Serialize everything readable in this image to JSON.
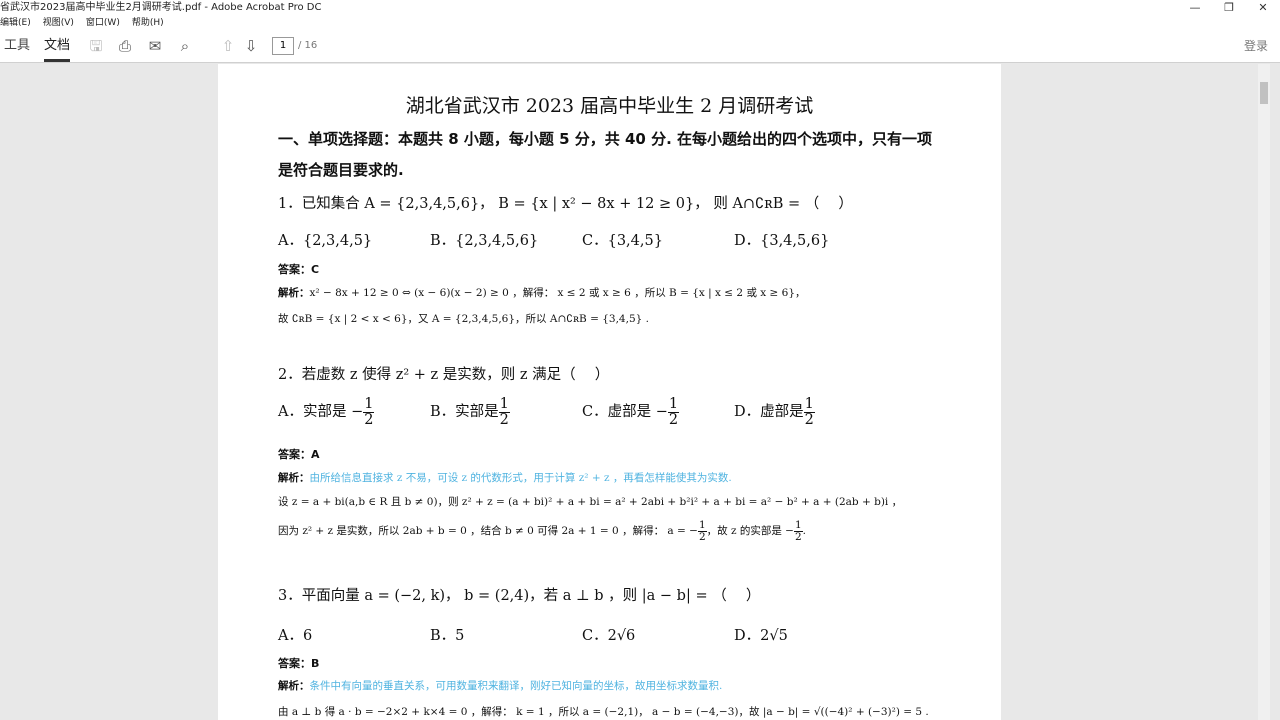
{
  "window": {
    "title": "省武汉市2023届高中毕业生2月调研考试.pdf - Adobe Acrobat Pro DC",
    "minimize": "—",
    "restore": "❐",
    "close": "✕"
  },
  "menu": [
    "编辑(E)",
    "视图(V)",
    "窗口(W)",
    "帮助(H)"
  ],
  "toolbar": {
    "tools": "工具",
    "document": "文档",
    "page_current": "1",
    "page_total": "/ 16",
    "login": "登录"
  },
  "doc": {
    "title": "湖北省武汉市 2023 届高中毕业生 2 月调研考试",
    "section_line1": "一、单项选择题：本题共 8 小题，每小题 5 分，共 40 分. 在每小题给出的四个选项中，只有一项",
    "section_line2": "是符合题目要求的.",
    "q1": {
      "stem": "1．已知集合 A = {2,3,4,5,6}， B = {x | x² − 8x + 12 ≥ 0}， 则 A∩∁ʀB = （　 ）",
      "options": [
        "A．{2,3,4,5}",
        "B．{2,3,4,5,6}",
        "C．{3,4,5}",
        "D．{3,4,5,6}"
      ],
      "answer": "答案：C",
      "exp_label": "解析：",
      "exp1": "x² − 8x + 12 ≥ 0 ⇔ (x − 6)(x − 2) ≥ 0 ，解得： x ≤ 2 或 x ≥ 6 ，所以 B = {x | x ≤ 2 或 x ≥ 6}，",
      "exp2": "故 ∁ʀB = {x | 2 < x < 6}，又 A = {2,3,4,5,6}，所以 A∩∁ʀB = {3,4,5} ."
    },
    "q2": {
      "stem": "2．若虚数 z 使得 z² + z 是实数，则 z 满足（　 ）",
      "options": [
        "A．实部是 −",
        "B．实部是",
        "C．虚部是 −",
        "D．虚部是"
      ],
      "frac_num": "1",
      "frac_den": "2",
      "answer": "答案：A",
      "exp_label": "解析：",
      "hint": "由所给信息直接求 z 不易，可设 z 的代数形式，用于计算 z² + z ，再看怎样能使其为实数.",
      "exp1": "设 z = a + bi(a,b ∈ R 且 b ≠ 0)，则 z² + z = (a + bi)² + a + bi = a² + 2abi + b²i² + a + bi = a² − b² + a + (2ab + b)i ，",
      "exp2a": "因为 z² + z 是实数，所以 2ab + b = 0 ，结合 b ≠ 0 可得 2a + 1 = 0 ，解得： a = −",
      "exp2b": "，故 z 的实部是 −",
      "exp2c": "."
    },
    "q3": {
      "stem": "3．平面向量 a = (−2, k)， b = (2,4)，若 a ⊥ b ，则 |a − b| = （　 ）",
      "options": [
        "A．6",
        "B．5",
        "C．2√6",
        "D．2√5"
      ],
      "answer": "答案：B",
      "exp_label": "解析：",
      "hint": "条件中有向量的垂直关系，可用数量积来翻译，刚好已知向量的坐标，故用坐标求数量积.",
      "exp1": "由 a ⊥ b 得 a · b = −2×2 + k×4 = 0 ，解得： k = 1 ，所以 a = (−2,1)， a − b = (−4,−3)，故 |a − b| = √((−4)² + (−3)²) = 5 ."
    }
  }
}
